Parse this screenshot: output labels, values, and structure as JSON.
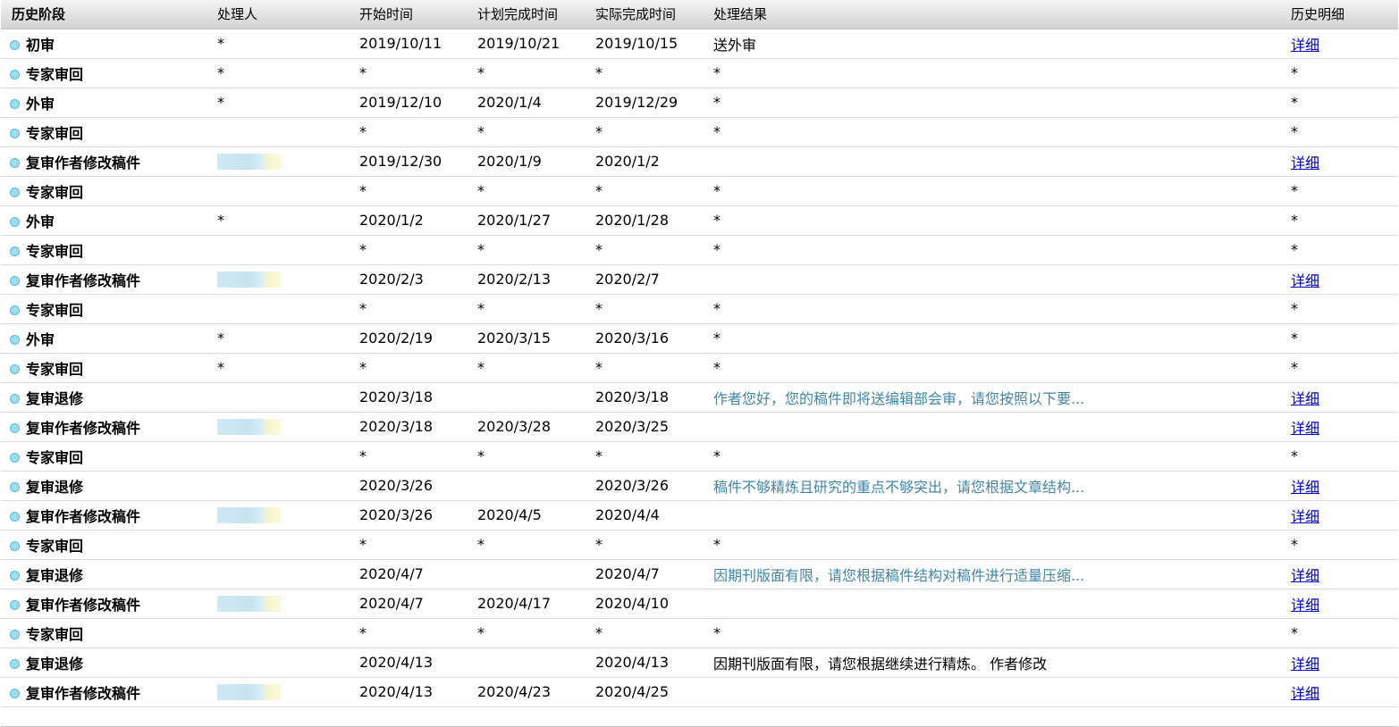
{
  "table": {
    "headers": [
      "历史阶段",
      "处理人",
      "开始时间",
      "计划完成时间",
      "实际完成时间",
      "处理结果",
      "历史明细"
    ],
    "rows": [
      {
        "stage": "初审",
        "handler": "*",
        "start": "2019/10/11",
        "plan": "2019/10/21",
        "actual": "2019/10/15",
        "result": "送外审",
        "detail": "详细",
        "blurred": false,
        "highlight": false
      },
      {
        "stage": "专家审回",
        "handler": "*",
        "start": "*",
        "plan": "*",
        "actual": "*",
        "result": "*",
        "detail": "*",
        "blurred": false,
        "highlight": false
      },
      {
        "stage": "外审",
        "handler": "*",
        "start": "2019/12/10",
        "plan": "2020/1/4",
        "actual": "2019/12/29",
        "result": "*",
        "detail": "*",
        "blurred": false,
        "highlight": false
      },
      {
        "stage": "专家审回",
        "handler": "",
        "start": "*",
        "plan": "*",
        "actual": "*",
        "result": "*",
        "detail": "*",
        "blurred": false,
        "highlight": false
      },
      {
        "stage": "复审作者修改稿件",
        "handler": "",
        "start": "2019/12/30",
        "plan": "2020/1/9",
        "actual": "2020/1/2",
        "result": "",
        "detail": "详细",
        "blurred": true,
        "highlight": false
      },
      {
        "stage": "专家审回",
        "handler": "",
        "start": "*",
        "plan": "*",
        "actual": "*",
        "result": "*",
        "detail": "*",
        "blurred": false,
        "highlight": false
      },
      {
        "stage": "外审",
        "handler": "*",
        "start": "2020/1/2",
        "plan": "2020/1/27",
        "actual": "2020/1/28",
        "result": "*",
        "detail": "*",
        "blurred": false,
        "highlight": false
      },
      {
        "stage": "专家审回",
        "handler": "",
        "start": "*",
        "plan": "*",
        "actual": "*",
        "result": "*",
        "detail": "*",
        "blurred": false,
        "highlight": false
      },
      {
        "stage": "复审作者修改稿件",
        "handler": "",
        "start": "2020/2/3",
        "plan": "2020/2/13",
        "actual": "2020/2/7",
        "result": "",
        "detail": "详细",
        "blurred": true,
        "highlight": false
      },
      {
        "stage": "专家审回",
        "handler": "",
        "start": "*",
        "plan": "*",
        "actual": "*",
        "result": "*",
        "detail": "*",
        "blurred": false,
        "highlight": false
      },
      {
        "stage": "外审",
        "handler": "*",
        "start": "2020/2/19",
        "plan": "2020/3/15",
        "actual": "2020/3/16",
        "result": "*",
        "detail": "*",
        "blurred": false,
        "highlight": false
      },
      {
        "stage": "专家审回",
        "handler": "*",
        "start": "*",
        "plan": "*",
        "actual": "*",
        "result": "*",
        "detail": "*",
        "blurred": false,
        "highlight": false
      },
      {
        "stage": "复审退修",
        "handler": "",
        "start": "2020/3/18",
        "plan": "",
        "actual": "2020/3/18",
        "result": "作者您好，您的稿件即将送编辑部会审，请您按照以下要...",
        "detail": "详细",
        "blurred": false,
        "highlight": true
      },
      {
        "stage": "复审作者修改稿件",
        "handler": "",
        "start": "2020/3/18",
        "plan": "2020/3/28",
        "actual": "2020/3/25",
        "result": "",
        "detail": "详细",
        "blurred": true,
        "highlight": false
      },
      {
        "stage": "专家审回",
        "handler": "",
        "start": "*",
        "plan": "*",
        "actual": "*",
        "result": "*",
        "detail": "*",
        "blurred": false,
        "highlight": false
      },
      {
        "stage": "复审退修",
        "handler": "",
        "start": "2020/3/26",
        "plan": "",
        "actual": "2020/3/26",
        "result": "稿件不够精炼且研究的重点不够突出，请您根据文章结构...",
        "detail": "详细",
        "blurred": false,
        "highlight": true
      },
      {
        "stage": "复审作者修改稿件",
        "handler": "",
        "start": "2020/3/26",
        "plan": "2020/4/5",
        "actual": "2020/4/4",
        "result": "",
        "detail": "详细",
        "blurred": true,
        "highlight": false
      },
      {
        "stage": "专家审回",
        "handler": "",
        "start": "*",
        "plan": "*",
        "actual": "*",
        "result": "*",
        "detail": "*",
        "blurred": false,
        "highlight": false
      },
      {
        "stage": "复审退修",
        "handler": "",
        "start": "2020/4/7",
        "plan": "",
        "actual": "2020/4/7",
        "result": "因期刊版面有限，请您根据稿件结构对稿件进行适量压缩...",
        "detail": "详细",
        "blurred": false,
        "highlight": true
      },
      {
        "stage": "复审作者修改稿件",
        "handler": "",
        "start": "2020/4/7",
        "plan": "2020/4/17",
        "actual": "2020/4/10",
        "result": "",
        "detail": "详细",
        "blurred": true,
        "highlight": false
      },
      {
        "stage": "专家审回",
        "handler": "",
        "start": "*",
        "plan": "*",
        "actual": "*",
        "result": "*",
        "detail": "*",
        "blurred": false,
        "highlight": false
      },
      {
        "stage": "复审退修",
        "handler": "",
        "start": "2020/4/13",
        "plan": "",
        "actual": "2020/4/13",
        "result": "因期刊版面有限，请您根据继续进行精炼。 作者修改",
        "detail": "详细",
        "blurred": false,
        "highlight": false
      },
      {
        "stage": "复审作者修改稿件",
        "handler": "",
        "start": "2020/4/13",
        "plan": "2020/4/23",
        "actual": "2020/4/25",
        "result": "",
        "detail": "详细",
        "blurred": true,
        "highlight": false
      }
    ]
  }
}
